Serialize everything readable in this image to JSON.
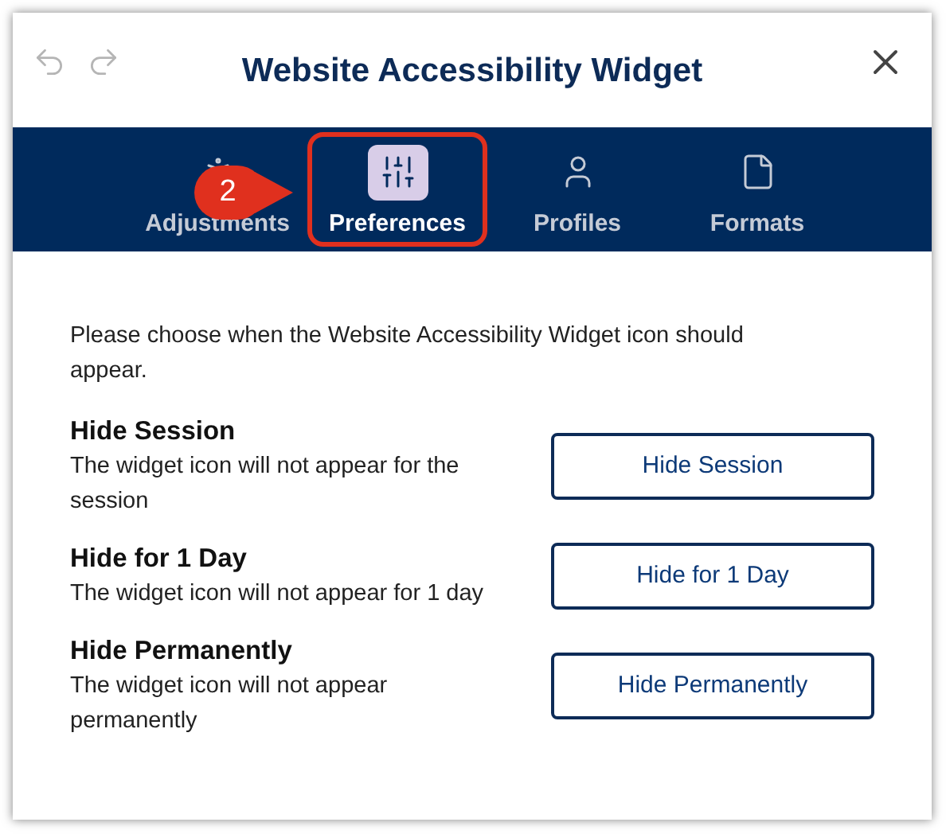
{
  "window": {
    "title": "Website Accessibility Widget"
  },
  "tabs": [
    {
      "label": "Adjustments",
      "kind": "accessibility",
      "selected": false
    },
    {
      "label": "Preferences",
      "kind": "sliders",
      "selected": true
    },
    {
      "label": "Profiles",
      "kind": "user",
      "selected": false
    },
    {
      "label": "Formats",
      "kind": "file",
      "selected": false
    }
  ],
  "callout": {
    "label": "2"
  },
  "intro": "Please choose when the Website Accessibility Widget icon should appear.",
  "options": [
    {
      "title": "Hide Session",
      "description": "The widget icon will not appear for the session",
      "button": "Hide Session"
    },
    {
      "title": "Hide for 1 Day",
      "description": "The widget icon will not appear for 1 day",
      "button": "Hide for 1 Day"
    },
    {
      "title": "Hide Permanently",
      "description": "The widget icon will not appear permanently",
      "button": "Hide Permanently"
    }
  ]
}
